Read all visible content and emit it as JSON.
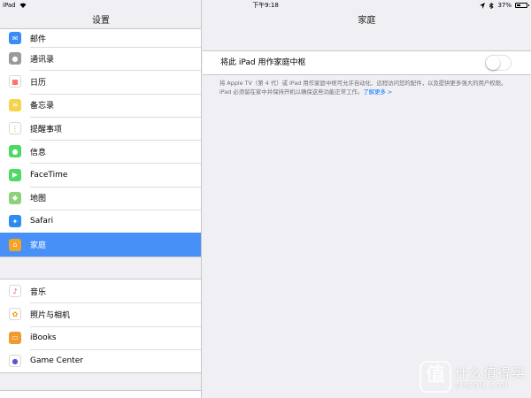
{
  "status_bar": {
    "carrier": "iPad",
    "time": "下午9:18",
    "battery": "37%",
    "battery_level": 0.37
  },
  "sidebar": {
    "title": "设置",
    "group1": [
      {
        "label": "邮件",
        "icon": "mail-icon",
        "color": "#3a8cf7"
      },
      {
        "label": "通讯录",
        "icon": "contacts-icon",
        "color": "#9b9b9b"
      },
      {
        "label": "日历",
        "icon": "calendar-icon",
        "color": "#ffffff"
      },
      {
        "label": "备忘录",
        "icon": "notes-icon",
        "color": "#f6d34a"
      },
      {
        "label": "提醒事项",
        "icon": "reminders-icon",
        "color": "#ffffff"
      },
      {
        "label": "信息",
        "icon": "messages-icon",
        "color": "#4cd964"
      },
      {
        "label": "FaceTime",
        "icon": "facetime-icon",
        "color": "#4cd964"
      },
      {
        "label": "地图",
        "icon": "maps-icon",
        "color": "#8fd17a"
      },
      {
        "label": "Safari",
        "icon": "safari-icon",
        "color": "#2d8cf0"
      },
      {
        "label": "家庭",
        "icon": "home-icon",
        "color": "#f7a326",
        "selected": true
      }
    ],
    "group2": [
      {
        "label": "音乐",
        "icon": "music-icon",
        "color": "#ffffff"
      },
      {
        "label": "照片与相机",
        "icon": "photos-icon",
        "color": "#ffffff"
      },
      {
        "label": "iBooks",
        "icon": "ibooks-icon",
        "color": "#f29a2e"
      },
      {
        "label": "Game Center",
        "icon": "game-center-icon",
        "color": "#ffffff"
      }
    ]
  },
  "detail": {
    "title": "家庭",
    "toggle_label": "将此 iPad 用作家庭中枢",
    "toggle_on": false,
    "footnote": "将 Apple TV（第 4 代）或 iPad 用作家庭中枢可允许自动化、远程访问您的配件，以及提供更多强大的用户权限。iPad 必须留在家中并保持开机以确保这些功能正常工作。",
    "learn_more": "了解更多 >"
  },
  "watermark": {
    "logo": "值",
    "text": "什么值得买",
    "domain": "SMZDM.COM"
  }
}
